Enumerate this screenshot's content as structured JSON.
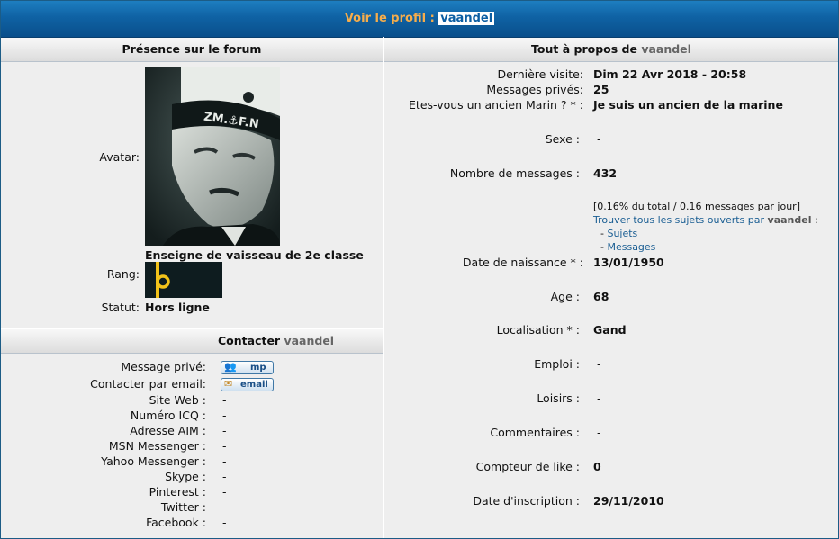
{
  "title": {
    "prefix": "Voir le profil :",
    "username": "vaandel"
  },
  "left": {
    "header": "Présence sur le forum",
    "avatar_label": "Avatar:",
    "rank_title": "Enseigne de vaisseau de 2e classe",
    "rank_label": "Rang:",
    "status_label": "Statut:",
    "status_value": "Hors ligne",
    "avatar_cap_text": "ZM.⚓F.N"
  },
  "contact": {
    "header_prefix": "Contacter",
    "username": "vaandel",
    "rows": [
      {
        "label": "Message privé:",
        "button": "mp",
        "icon": "users-icon"
      },
      {
        "label": "Contacter par email:",
        "button": "email",
        "icon": "envelope-icon"
      },
      {
        "label": "Site Web :",
        "value": "-"
      },
      {
        "label": "Numéro ICQ :",
        "value": "-"
      },
      {
        "label": "Adresse AIM :",
        "value": "-"
      },
      {
        "label": "MSN Messenger :",
        "value": "-"
      },
      {
        "label": "Yahoo Messenger :",
        "value": "-"
      },
      {
        "label": "Skype :",
        "value": "-"
      },
      {
        "label": "Pinterest :",
        "value": "-"
      },
      {
        "label": "Twitter :",
        "value": "-"
      },
      {
        "label": "Facebook :",
        "value": "-"
      }
    ]
  },
  "right": {
    "header_prefix": "Tout à propos de",
    "username": "vaandel",
    "derniere_label": "Dernière visite:",
    "derniere_value": "Dim 22 Avr 2018 - 20:58",
    "mp_label": "Messages privés:",
    "mp_value": "25",
    "marin_label": "Etes-vous un ancien Marin ? * :",
    "marin_value": "Je suis un ancien de la marine",
    "sexe_label": "Sexe :",
    "sexe_value": "-",
    "nbmsg_label": "Nombre de messages :",
    "nbmsg_value": "432",
    "stats": "[0.16% du total / 0.16 messages par jour]",
    "find_prefix": "Trouver tous les sujets ouverts par",
    "find_user": "vaandel",
    "find_colon": ":",
    "sujets_link": "Sujets",
    "messages_link": "Messages",
    "naissance_label": "Date de naissance * :",
    "naissance_value": "13/01/1950",
    "age_label": "Age :",
    "age_value": "68",
    "loc_label": "Localisation * :",
    "loc_value": "Gand",
    "emploi_label": "Emploi :",
    "emploi_value": "-",
    "loisirs_label": "Loisirs :",
    "loisirs_value": "-",
    "comm_label": "Commentaires :",
    "comm_value": "-",
    "like_label": "Compteur de like :",
    "like_value": "0",
    "insc_label": "Date d'inscription :",
    "insc_value": "29/11/2010"
  }
}
